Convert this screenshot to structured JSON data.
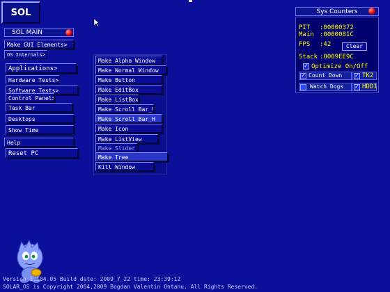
{
  "logo": {
    "label": "SOL"
  },
  "main_window": {
    "title": "SOL MAIN",
    "items": [
      "Make GUI Elements>",
      "OS Internals>",
      "Applications>",
      "Hardware Tests>",
      "Software Tests>",
      "Control Panel>",
      "Task Bar",
      "Desktops",
      "Show Time",
      "Help",
      "Reset PC"
    ]
  },
  "submenu": {
    "items": [
      "Make Alpha Window",
      "Make Normal Window",
      "Make Button",
      "Make EditBox",
      "Make ListBox",
      "Make Scroll Bar_V",
      "Make Scroll Bar_H",
      "Make Icon",
      "Make ListView",
      "Make Slider",
      "Make Tree",
      "Kill Window"
    ]
  },
  "counters": {
    "title": "Sys Counters",
    "pit_label": "PIT",
    "pit_value": ":00000372",
    "main_label": "Main",
    "main_value": ":0000081C",
    "fps_label": "FPS",
    "fps_value": ":42",
    "clear_label": "Clear",
    "stack_label": "Stack",
    "stack_value": ":0009EE9C",
    "optimize_label": "Optimize On/Off",
    "count_down_label": "Count Down",
    "watch_dogs_label": "Watch Dogs",
    "tk2_label": "TK2",
    "hdd1_label": "HDD1"
  },
  "footer": {
    "version_line": "Version 1.104.05  Build date: 2009_7_22  time: 23:39:12",
    "copyright_line": "SOLAR_OS is Copyright 2004,2009 Bogdan Valentin Ontanu. All Rights Reserved."
  },
  "colors": {
    "background": "#0b0f9a",
    "counter_text": "#ffff00",
    "close_button": "#e00000"
  },
  "icons": [
    "close-icon",
    "check-icon",
    "mascot-icon",
    "mouse-cursor-icon"
  ]
}
